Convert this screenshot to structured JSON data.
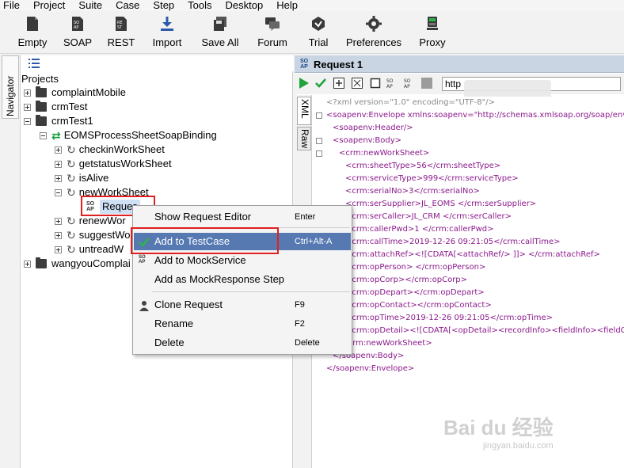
{
  "menubar": [
    "File",
    "Project",
    "Suite",
    "Case",
    "Step",
    "Tools",
    "Desktop",
    "Help"
  ],
  "toolbar": {
    "empty": "Empty",
    "soap": "SOAP",
    "rest": "REST",
    "import": "Import",
    "save_all": "Save All",
    "forum": "Forum",
    "trial": "Trial",
    "preferences": "Preferences",
    "proxy": "Proxy"
  },
  "navigator": {
    "tab": "Navigator",
    "projects_label": "Projects"
  },
  "tree": {
    "p1": "complaintMobile",
    "p2": "crmTest",
    "p3": "crmTest1",
    "binding": "EOMSProcessSheetSoapBinding",
    "op1": "checkinWorkSheet",
    "op2": "getstatusWorkSheet",
    "op3": "isAlive",
    "op4": "newWorkSheet",
    "req": "Reques",
    "op5": "renewWor",
    "op6": "suggestWo",
    "op7": "untreadW",
    "p4": "wangyouComplai"
  },
  "context_menu": {
    "items": [
      {
        "label": "Show Request Editor",
        "key": "Enter"
      },
      {
        "label": "Add to TestCase",
        "key": "Ctrl+Alt-A"
      },
      {
        "label": "Add to MockService",
        "key": ""
      },
      {
        "label": "Add as MockResponse Step",
        "key": ""
      },
      {
        "label": "Clone Request",
        "key": "F9"
      },
      {
        "label": "Rename",
        "key": "F2"
      },
      {
        "label": "Delete",
        "key": "Delete"
      }
    ]
  },
  "editor": {
    "title": "Request 1",
    "url": "http",
    "vtab_xml": "XML",
    "vtab_raw": "Raw",
    "xml_lines": [
      "<?xml version=\"1.0\" encoding=\"UTF-8\"/>",
      "<soapenv:Envelope xmlns:soapenv=\"http://schemas.xmlsoap.org/soap/envelo",
      "<soapenv:Header/>",
      "<soapenv:Body>",
      "<crm:newWorkSheet>",
      "<crm:sheetType>56</crm:sheetType>",
      "<crm:serviceType>999</crm:serviceType>",
      "<crm:serialNo>3</crm:serialNo>",
      "<crm:serSupplier>JL_EOMS </crm:serSupplier>",
      "<crm:serCaller>JL_CRM </crm:serCaller>",
      "<crm:callerPwd>1 </crm:callerPwd>",
      "<crm:callTime>2019-12-26 09:21:05</crm:callTime>",
      "<crm:attachRef><![CDATA[<attachRef/> ]]> </crm:attachRef>",
      "<crm:opPerson> </crm:opPerson>",
      "<crm:opCorp></crm:opCorp>",
      "<crm:opDepart></crm:opDepart>",
      "<crm:opContact></crm:opContact>",
      "<crm:opTime>2019-12-26 09:21:05</crm:opTime>",
      "<crm:opDetail><![CDATA[<opDetail><recordInfo><fieldInfo><fieldChName",
      "</crm:newWorkSheet>",
      "</soapenv:Body>",
      "</soapenv:Envelope>"
    ]
  },
  "watermark": {
    "main": "Bai du 经验",
    "sub": "jingyan.baidu.com"
  }
}
